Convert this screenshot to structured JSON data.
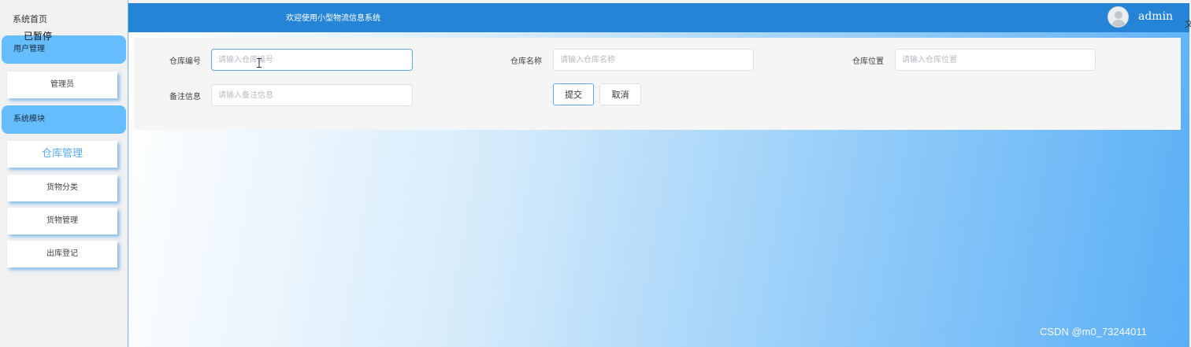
{
  "sidebar": {
    "home": "系统首页",
    "paused": "已暂停",
    "groups": [
      {
        "label": "用户管理",
        "items": [
          "管理员"
        ]
      },
      {
        "label": "系统模块",
        "items": [
          "仓库管理",
          "货物分类",
          "货物管理",
          "出库登记"
        ]
      }
    ],
    "active_item": "仓库管理"
  },
  "header": {
    "welcome": "欢迎使用小型物流信息系统",
    "user_name": "admin",
    "avatar_icon": "user-avatar-icon",
    "edge_glyph": "文"
  },
  "form": {
    "fields": [
      {
        "label": "仓库编号",
        "placeholder": "请输入仓库编号"
      },
      {
        "label": "仓库名称",
        "placeholder": "请输入仓库名称"
      },
      {
        "label": "仓库位置",
        "placeholder": "请输入仓库位置"
      },
      {
        "label": "备注信息",
        "placeholder": "请输入备注信息"
      }
    ],
    "submit_label": "提交",
    "cancel_label": "取消"
  },
  "watermark": "CSDN @m0_73244011",
  "colors": {
    "header": "#2584d6",
    "group_header": "#66bdfd",
    "accent": "#5aaef0"
  }
}
